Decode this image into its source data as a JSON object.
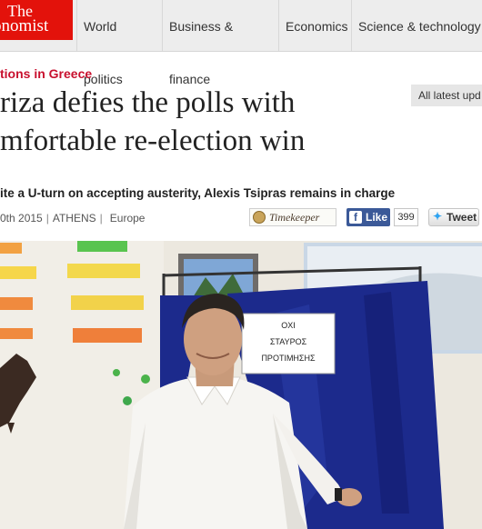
{
  "nav": {
    "logo_line1": "The",
    "logo_line2": "onomist",
    "items": [
      "World politics",
      "Business & finance",
      "Economics",
      "Science & technology"
    ]
  },
  "article": {
    "section": "tions in Greece",
    "headline_line1": "riza defies the polls with",
    "headline_line2": "mfortable re-election win",
    "rubric": "ite a U-turn on accepting austerity, Alexis Tsipras remains in charge",
    "date": "0th 2015",
    "location": "ATHENS",
    "category": "Europe"
  },
  "sidebar": {
    "all_latest": "All latest upd"
  },
  "share": {
    "timekeeper_label": "Timekeeper",
    "like_label": "Like",
    "like_count": "399",
    "tweet_label": "Tweet"
  },
  "photo": {
    "sign_line1": "ΟΧΙ",
    "sign_line2": "ΣΤΑΥΡΟΣ",
    "sign_line3": "ΠΡΟΤΙΜΗΣΗΣ"
  },
  "colors": {
    "brand_red": "#e3120b",
    "section_red": "#c8102e",
    "facebook_blue": "#3b5998",
    "twitter_blue": "#2ea3f2",
    "booth_blue": "#1c2a8c"
  }
}
